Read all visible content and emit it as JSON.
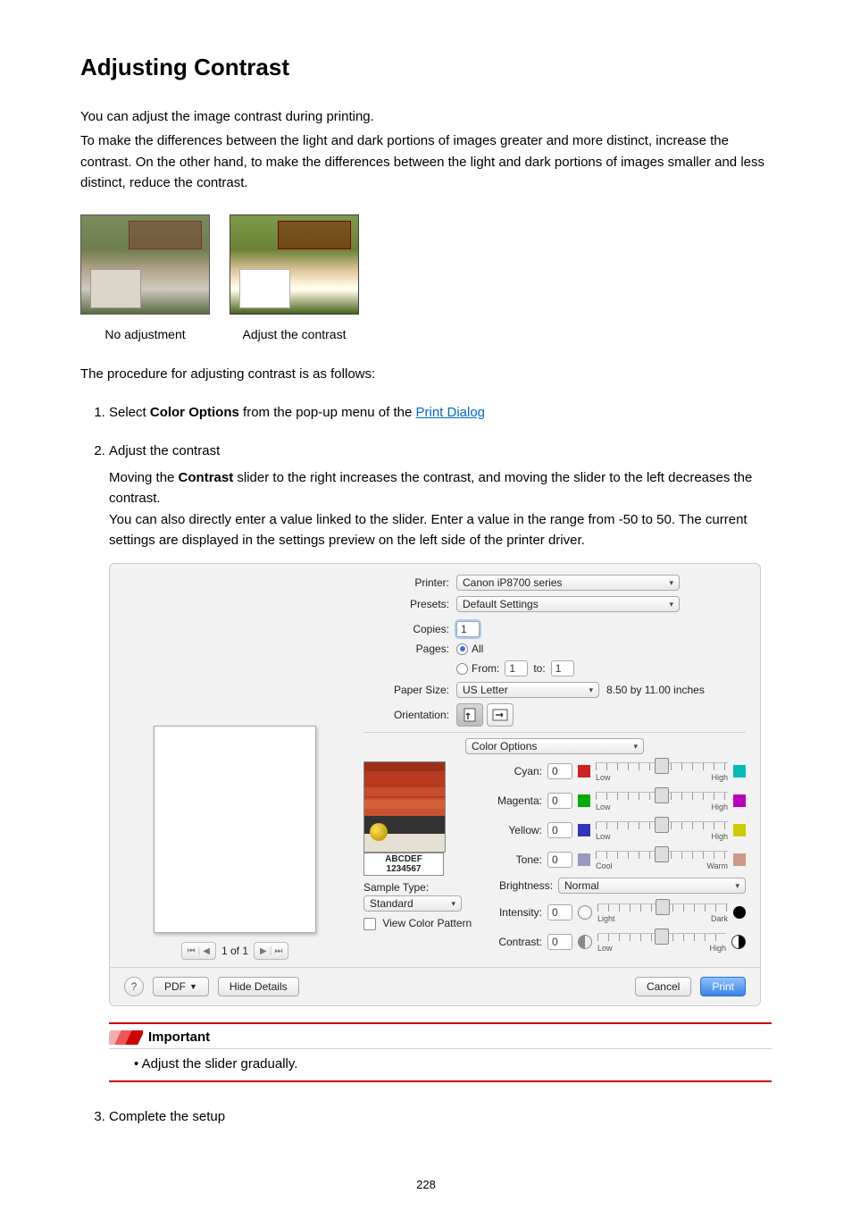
{
  "heading": "Adjusting Contrast",
  "intro1": "You can adjust the image contrast during printing.",
  "intro2": "To make the differences between the light and dark portions of images greater and more distinct, increase the contrast. On the other hand, to make the differences between the light and dark portions of images smaller and less distinct, reduce the contrast.",
  "captions": {
    "noadj": "No adjustment",
    "adj": "Adjust the contrast"
  },
  "proc_intro": "The procedure for adjusting contrast is as follows:",
  "step1": {
    "pre": "Select ",
    "bold": "Color Options",
    "mid": " from the pop-up menu of the ",
    "link": "Print Dialog"
  },
  "step2": {
    "title": "Adjust the contrast",
    "p1_pre": "Moving the ",
    "p1_bold": "Contrast",
    "p1_post": " slider to the right increases the contrast, and moving the slider to the left decreases the contrast.",
    "p2": "You can also directly enter a value linked to the slider. Enter a value in the range from -50 to 50. The current settings are displayed in the settings preview on the left side of the printer driver."
  },
  "step3": {
    "title": "Complete the setup"
  },
  "important": {
    "label": "Important",
    "bullet": "Adjust the slider gradually."
  },
  "pagenum": "228",
  "dialog": {
    "labels": {
      "printer": "Printer:",
      "presets": "Presets:",
      "copies": "Copies:",
      "pages": "Pages:",
      "all": "All",
      "from": "From:",
      "to": "to:",
      "papersize": "Paper Size:",
      "dims": "8.50 by 11.00 inches",
      "orientation": "Orientation:",
      "popup": "Color Options",
      "cyan": "Cyan:",
      "magenta": "Magenta:",
      "yellow": "Yellow:",
      "tone": "Tone:",
      "brightness": "Brightness:",
      "intensity": "Intensity:",
      "contrast": "Contrast:",
      "low": "Low",
      "high": "High",
      "cool": "Cool",
      "warm": "Warm",
      "light": "Light",
      "dark": "Dark",
      "sampletype": "Sample Type:",
      "standard": "Standard",
      "viewcolor": "View Color Pattern",
      "thumb1": "ABCDEF",
      "thumb2": "1234567",
      "pager": "1 of 1"
    },
    "values": {
      "printer": "Canon iP8700 series",
      "presets": "Default Settings",
      "copies": "1",
      "from": "1",
      "to": "1",
      "papersize": "US Letter",
      "brightness": "Normal",
      "cyan": "0",
      "magenta": "0",
      "yellow": "0",
      "tone": "0",
      "intensity": "0",
      "contrast": "0"
    },
    "buttons": {
      "help": "?",
      "pdf": "PDF",
      "hide": "Hide Details",
      "cancel": "Cancel",
      "print": "Print"
    }
  }
}
